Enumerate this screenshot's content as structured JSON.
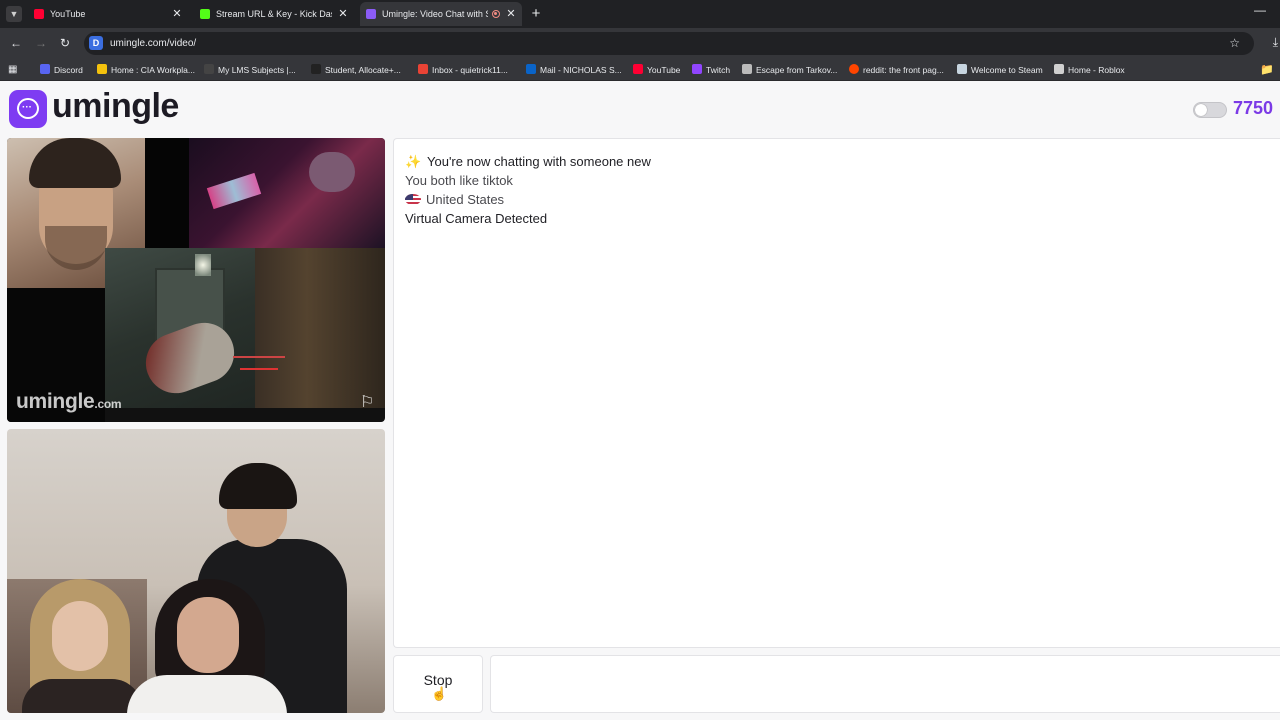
{
  "browser": {
    "tabs": [
      {
        "title": "YouTube",
        "active": false,
        "favicon": "youtube-icon",
        "color": "#ff0033"
      },
      {
        "title": "Stream URL & Key - Kick Dashb",
        "active": false,
        "favicon": "kick-icon",
        "color": "#53fc18"
      },
      {
        "title": "Umingle: Video Chat with St",
        "active": true,
        "favicon": "umingle-icon",
        "color": "#8b5cf6"
      }
    ],
    "address": "umingle.com/video/",
    "bookmarks": [
      {
        "label": "Discord",
        "icon": "discord-icon",
        "color": "#5865f2"
      },
      {
        "label": "Home : CIA Workpla...",
        "icon": "cia-icon",
        "color": "#f4c20d"
      },
      {
        "label": "My LMS Subjects |...",
        "icon": "lms-icon",
        "color": "#444"
      },
      {
        "label": "Student, Allocate+...",
        "icon": "allocate-icon",
        "color": "#222"
      },
      {
        "label": "Inbox - quietrick11...",
        "icon": "gmail-icon",
        "color": "#ea4335"
      },
      {
        "label": "Mail - NICHOLAS S...",
        "icon": "outlook-icon",
        "color": "#0a64c8"
      },
      {
        "label": "YouTube",
        "icon": "youtube-icon",
        "color": "#ff0033"
      },
      {
        "label": "Twitch",
        "icon": "twitch-icon",
        "color": "#9146ff"
      },
      {
        "label": "Escape from Tarkov...",
        "icon": "tarkov-icon",
        "color": "#bbb"
      },
      {
        "label": "reddit: the front pag...",
        "icon": "reddit-icon",
        "color": "#ff4500"
      },
      {
        "label": "Welcome to Steam",
        "icon": "steam-icon",
        "color": "#c7d5e0"
      },
      {
        "label": "Home - Roblox",
        "icon": "roblox-icon",
        "color": "#d0d0d0"
      }
    ]
  },
  "site": {
    "logo": "umingle",
    "online_count": "7750",
    "accent": "#7e3cf2"
  },
  "remote_video": {
    "watermark": "umingle",
    "watermark_tld": ".com"
  },
  "chat": {
    "messages": [
      "You're now chatting with someone new",
      "You both like tiktok",
      "United States",
      "Virtual Camera Detected"
    ]
  },
  "controls": {
    "stop_label": "Stop",
    "message_placeholder": ""
  }
}
